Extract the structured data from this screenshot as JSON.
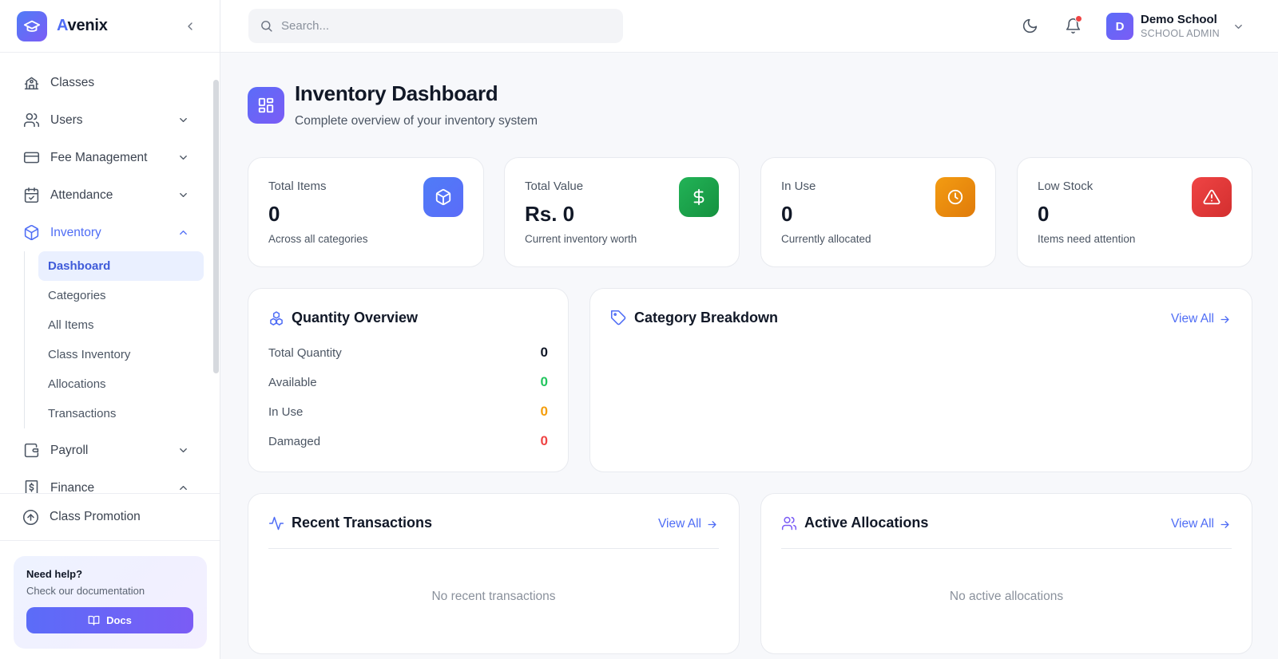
{
  "brand": {
    "name_prefix": "A",
    "name_rest": "venix"
  },
  "sidebar": {
    "items": [
      {
        "label": "Classes",
        "icon": "school-icon"
      },
      {
        "label": "Users",
        "icon": "users-icon"
      },
      {
        "label": "Fee Management",
        "icon": "credit-card-icon"
      },
      {
        "label": "Attendance",
        "icon": "calendar-check-icon"
      },
      {
        "label": "Inventory",
        "icon": "package-icon"
      },
      {
        "label": "Payroll",
        "icon": "wallet-icon"
      },
      {
        "label": "Finance",
        "icon": "receipt-icon"
      }
    ],
    "inventory_sub": [
      {
        "label": "Dashboard"
      },
      {
        "label": "Categories"
      },
      {
        "label": "All Items"
      },
      {
        "label": "Class Inventory"
      },
      {
        "label": "Allocations"
      },
      {
        "label": "Transactions"
      }
    ],
    "promotion": {
      "label": "Class Promotion",
      "icon": "arrow-up-circle-icon"
    },
    "help": {
      "title": "Need help?",
      "subtitle": "Check our documentation",
      "button": "Docs"
    }
  },
  "header": {
    "search_placeholder": "Search...",
    "user": {
      "initial": "D",
      "name": "Demo School",
      "role": "SCHOOL ADMIN"
    }
  },
  "page": {
    "title": "Inventory Dashboard",
    "subtitle": "Complete overview of your inventory system"
  },
  "stats": [
    {
      "label": "Total Items",
      "value": "0",
      "sub": "Across all categories",
      "icon": "box-icon",
      "color": "#4f7cf7"
    },
    {
      "label": "Total Value",
      "value": "Rs. 0",
      "sub": "Current inventory worth",
      "icon": "dollar-icon",
      "color": "#16a34a"
    },
    {
      "label": "In Use",
      "value": "0",
      "sub": "Currently allocated",
      "icon": "clock-icon",
      "color": "#ea8a0c"
    },
    {
      "label": "Low Stock",
      "value": "0",
      "sub": "Items need attention",
      "icon": "alert-triangle-icon",
      "color": "#e53935"
    }
  ],
  "quantity_overview": {
    "title": "Quantity Overview",
    "rows": [
      {
        "label": "Total Quantity",
        "value": "0",
        "color": "#111827"
      },
      {
        "label": "Available",
        "value": "0",
        "color": "#22c55e"
      },
      {
        "label": "In Use",
        "value": "0",
        "color": "#f59e0b"
      },
      {
        "label": "Damaged",
        "value": "0",
        "color": "#ef4444"
      }
    ]
  },
  "category_breakdown": {
    "title": "Category Breakdown",
    "view_all": "View All"
  },
  "recent_transactions": {
    "title": "Recent Transactions",
    "view_all": "View All",
    "empty": "No recent transactions"
  },
  "active_allocations": {
    "title": "Active Allocations",
    "view_all": "View All",
    "empty": "No active allocations"
  },
  "colors": {
    "accent": "#4f6df5",
    "accent_purple": "#7b5cf5"
  }
}
